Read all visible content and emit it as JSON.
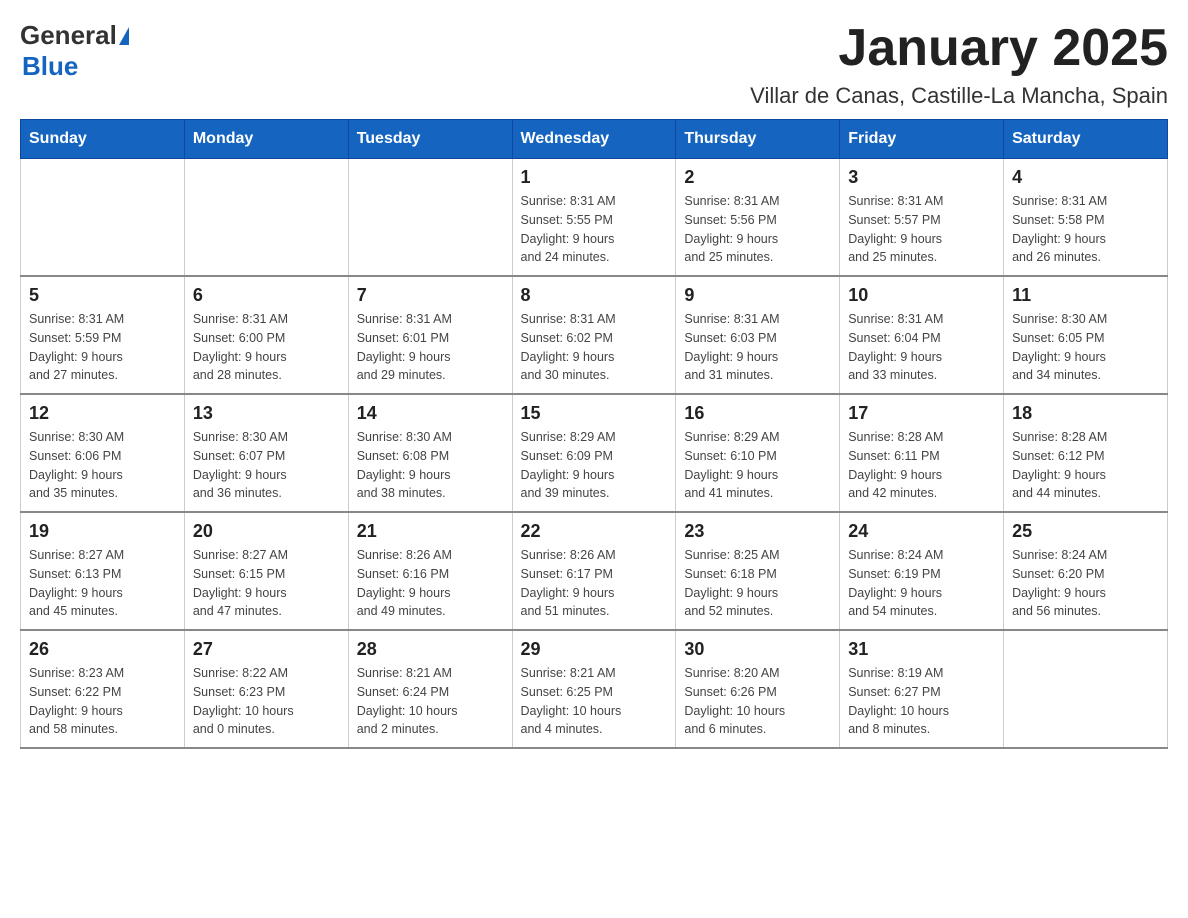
{
  "header": {
    "logo_general": "General",
    "logo_blue": "Blue",
    "title": "January 2025",
    "subtitle": "Villar de Canas, Castille-La Mancha, Spain"
  },
  "days_of_week": [
    "Sunday",
    "Monday",
    "Tuesday",
    "Wednesday",
    "Thursday",
    "Friday",
    "Saturday"
  ],
  "weeks": [
    {
      "days": [
        {
          "number": "",
          "info": ""
        },
        {
          "number": "",
          "info": ""
        },
        {
          "number": "",
          "info": ""
        },
        {
          "number": "1",
          "info": "Sunrise: 8:31 AM\nSunset: 5:55 PM\nDaylight: 9 hours\nand 24 minutes."
        },
        {
          "number": "2",
          "info": "Sunrise: 8:31 AM\nSunset: 5:56 PM\nDaylight: 9 hours\nand 25 minutes."
        },
        {
          "number": "3",
          "info": "Sunrise: 8:31 AM\nSunset: 5:57 PM\nDaylight: 9 hours\nand 25 minutes."
        },
        {
          "number": "4",
          "info": "Sunrise: 8:31 AM\nSunset: 5:58 PM\nDaylight: 9 hours\nand 26 minutes."
        }
      ]
    },
    {
      "days": [
        {
          "number": "5",
          "info": "Sunrise: 8:31 AM\nSunset: 5:59 PM\nDaylight: 9 hours\nand 27 minutes."
        },
        {
          "number": "6",
          "info": "Sunrise: 8:31 AM\nSunset: 6:00 PM\nDaylight: 9 hours\nand 28 minutes."
        },
        {
          "number": "7",
          "info": "Sunrise: 8:31 AM\nSunset: 6:01 PM\nDaylight: 9 hours\nand 29 minutes."
        },
        {
          "number": "8",
          "info": "Sunrise: 8:31 AM\nSunset: 6:02 PM\nDaylight: 9 hours\nand 30 minutes."
        },
        {
          "number": "9",
          "info": "Sunrise: 8:31 AM\nSunset: 6:03 PM\nDaylight: 9 hours\nand 31 minutes."
        },
        {
          "number": "10",
          "info": "Sunrise: 8:31 AM\nSunset: 6:04 PM\nDaylight: 9 hours\nand 33 minutes."
        },
        {
          "number": "11",
          "info": "Sunrise: 8:30 AM\nSunset: 6:05 PM\nDaylight: 9 hours\nand 34 minutes."
        }
      ]
    },
    {
      "days": [
        {
          "number": "12",
          "info": "Sunrise: 8:30 AM\nSunset: 6:06 PM\nDaylight: 9 hours\nand 35 minutes."
        },
        {
          "number": "13",
          "info": "Sunrise: 8:30 AM\nSunset: 6:07 PM\nDaylight: 9 hours\nand 36 minutes."
        },
        {
          "number": "14",
          "info": "Sunrise: 8:30 AM\nSunset: 6:08 PM\nDaylight: 9 hours\nand 38 minutes."
        },
        {
          "number": "15",
          "info": "Sunrise: 8:29 AM\nSunset: 6:09 PM\nDaylight: 9 hours\nand 39 minutes."
        },
        {
          "number": "16",
          "info": "Sunrise: 8:29 AM\nSunset: 6:10 PM\nDaylight: 9 hours\nand 41 minutes."
        },
        {
          "number": "17",
          "info": "Sunrise: 8:28 AM\nSunset: 6:11 PM\nDaylight: 9 hours\nand 42 minutes."
        },
        {
          "number": "18",
          "info": "Sunrise: 8:28 AM\nSunset: 6:12 PM\nDaylight: 9 hours\nand 44 minutes."
        }
      ]
    },
    {
      "days": [
        {
          "number": "19",
          "info": "Sunrise: 8:27 AM\nSunset: 6:13 PM\nDaylight: 9 hours\nand 45 minutes."
        },
        {
          "number": "20",
          "info": "Sunrise: 8:27 AM\nSunset: 6:15 PM\nDaylight: 9 hours\nand 47 minutes."
        },
        {
          "number": "21",
          "info": "Sunrise: 8:26 AM\nSunset: 6:16 PM\nDaylight: 9 hours\nand 49 minutes."
        },
        {
          "number": "22",
          "info": "Sunrise: 8:26 AM\nSunset: 6:17 PM\nDaylight: 9 hours\nand 51 minutes."
        },
        {
          "number": "23",
          "info": "Sunrise: 8:25 AM\nSunset: 6:18 PM\nDaylight: 9 hours\nand 52 minutes."
        },
        {
          "number": "24",
          "info": "Sunrise: 8:24 AM\nSunset: 6:19 PM\nDaylight: 9 hours\nand 54 minutes."
        },
        {
          "number": "25",
          "info": "Sunrise: 8:24 AM\nSunset: 6:20 PM\nDaylight: 9 hours\nand 56 minutes."
        }
      ]
    },
    {
      "days": [
        {
          "number": "26",
          "info": "Sunrise: 8:23 AM\nSunset: 6:22 PM\nDaylight: 9 hours\nand 58 minutes."
        },
        {
          "number": "27",
          "info": "Sunrise: 8:22 AM\nSunset: 6:23 PM\nDaylight: 10 hours\nand 0 minutes."
        },
        {
          "number": "28",
          "info": "Sunrise: 8:21 AM\nSunset: 6:24 PM\nDaylight: 10 hours\nand 2 minutes."
        },
        {
          "number": "29",
          "info": "Sunrise: 8:21 AM\nSunset: 6:25 PM\nDaylight: 10 hours\nand 4 minutes."
        },
        {
          "number": "30",
          "info": "Sunrise: 8:20 AM\nSunset: 6:26 PM\nDaylight: 10 hours\nand 6 minutes."
        },
        {
          "number": "31",
          "info": "Sunrise: 8:19 AM\nSunset: 6:27 PM\nDaylight: 10 hours\nand 8 minutes."
        },
        {
          "number": "",
          "info": ""
        }
      ]
    }
  ]
}
